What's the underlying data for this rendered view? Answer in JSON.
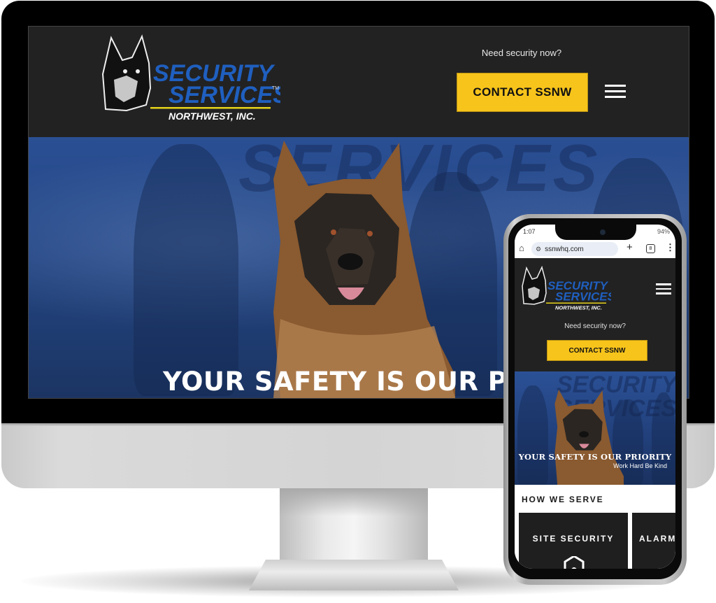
{
  "desktop": {
    "header": {
      "logo": {
        "line1": "SECURITY",
        "line2": "SERVICES",
        "trademark": "TM",
        "line3": "NORTHWEST, INC."
      },
      "need_security_text": "Need security now?",
      "contact_button": "CONTACT SSNW",
      "menu_icon": "hamburger-menu-icon"
    },
    "hero": {
      "background_text": "SERVICES",
      "title": "YOUR SAFETY IS OUR PRIO"
    }
  },
  "mobile": {
    "status_bar": {
      "time": "1:07",
      "battery": "94%"
    },
    "browser": {
      "url": "ssnwhq.com",
      "tab_count": "8",
      "home_icon": "home-icon",
      "new_tab_icon": "plus-icon",
      "menu_icon": "more-vert-icon"
    },
    "header": {
      "logo": {
        "line1": "SECURITY",
        "line2": "SERVICES",
        "line3": "NORTHWEST, INC."
      },
      "need_security_text": "Need security now?",
      "contact_button": "CONTACT SSNW"
    },
    "hero": {
      "background_text": "SECURITY SERVICES",
      "title": "YOUR SAFETY IS OUR PRIORITY",
      "subtitle": "Work Hard Be Kind"
    },
    "how_we_serve": {
      "title": "HOW WE SERVE",
      "cards": [
        {
          "label": "SITE SECURITY",
          "icon": "shield-guard-icon"
        },
        {
          "label": "ALARM",
          "icon": "alarm-icon"
        }
      ]
    }
  },
  "colors": {
    "accent_yellow": "#f7c41b",
    "header_dark": "#222222",
    "brand_blue": "#1f5fbf",
    "hero_blue": "#2a4f93"
  }
}
